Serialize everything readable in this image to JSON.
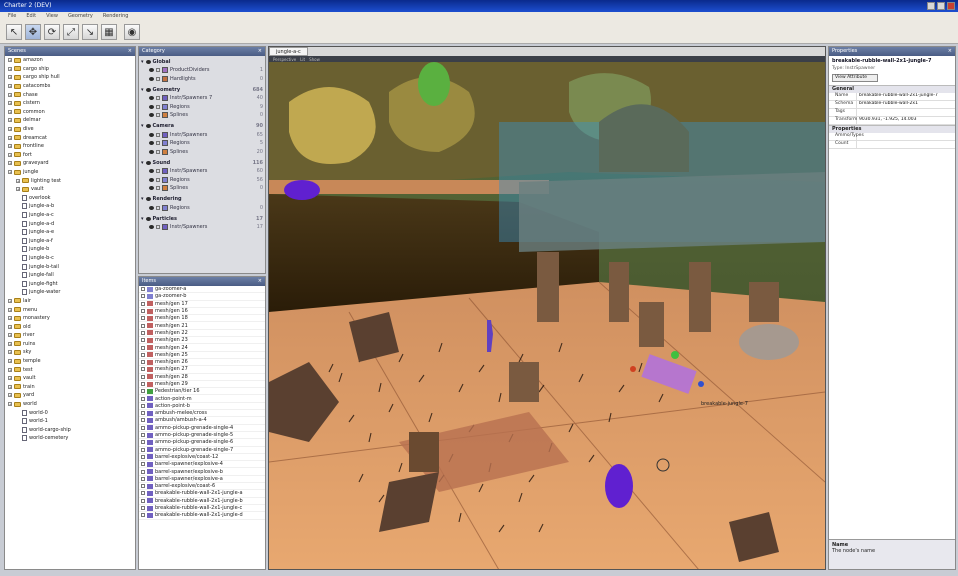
{
  "window": {
    "title": "Charter 2 (DEV)"
  },
  "menu": [
    "File",
    "Edit",
    "View",
    "Geometry",
    "Rendering"
  ],
  "toolbar": {
    "tools": [
      "select-tool",
      "move-tool",
      "rotate-tool",
      "scale-tool",
      "place-tool",
      "grid-tool",
      "render-tool"
    ]
  },
  "left_panel": {
    "title": "Scenes",
    "items": [
      {
        "label": "amazon",
        "type": "folder",
        "depth": 0
      },
      {
        "label": "cargo ship",
        "type": "folder",
        "depth": 0
      },
      {
        "label": "cargo ship hull",
        "type": "folder",
        "depth": 0
      },
      {
        "label": "catacombs",
        "type": "folder",
        "depth": 0
      },
      {
        "label": "chase",
        "type": "folder",
        "depth": 0
      },
      {
        "label": "cistern",
        "type": "folder",
        "depth": 0
      },
      {
        "label": "common",
        "type": "folder",
        "depth": 0
      },
      {
        "label": "delmar",
        "type": "folder",
        "depth": 0
      },
      {
        "label": "dive",
        "type": "folder",
        "depth": 0
      },
      {
        "label": "dreamcat",
        "type": "folder",
        "depth": 0
      },
      {
        "label": "frontline",
        "type": "folder",
        "depth": 0
      },
      {
        "label": "fort",
        "type": "folder",
        "depth": 0
      },
      {
        "label": "graveyard",
        "type": "folder",
        "depth": 0
      },
      {
        "label": "jungle",
        "type": "folder",
        "depth": 0
      },
      {
        "label": "lighting test",
        "type": "folder",
        "depth": 1
      },
      {
        "label": "vault",
        "type": "folder",
        "depth": 1
      },
      {
        "label": "overlook",
        "type": "file",
        "depth": 1
      },
      {
        "label": "jungle-a-b",
        "type": "file",
        "depth": 1
      },
      {
        "label": "jungle-a-c",
        "type": "file",
        "depth": 1
      },
      {
        "label": "jungle-a-d",
        "type": "file",
        "depth": 1
      },
      {
        "label": "jungle-a-e",
        "type": "file",
        "depth": 1
      },
      {
        "label": "jungle-a-f",
        "type": "file",
        "depth": 1
      },
      {
        "label": "jungle-b",
        "type": "file",
        "depth": 1
      },
      {
        "label": "jungle-b-c",
        "type": "file",
        "depth": 1
      },
      {
        "label": "jungle-b-tail",
        "type": "file",
        "depth": 1
      },
      {
        "label": "jungle-fall",
        "type": "file",
        "depth": 1
      },
      {
        "label": "jungle-fight",
        "type": "file",
        "depth": 1
      },
      {
        "label": "jungle-water",
        "type": "file",
        "depth": 1
      },
      {
        "label": "lair",
        "type": "folder",
        "depth": 0
      },
      {
        "label": "menu",
        "type": "folder",
        "depth": 0
      },
      {
        "label": "monastery",
        "type": "folder",
        "depth": 0
      },
      {
        "label": "old",
        "type": "folder",
        "depth": 0
      },
      {
        "label": "river",
        "type": "folder",
        "depth": 0
      },
      {
        "label": "ruins",
        "type": "folder",
        "depth": 0
      },
      {
        "label": "sky",
        "type": "folder",
        "depth": 0
      },
      {
        "label": "temple",
        "type": "folder",
        "depth": 0
      },
      {
        "label": "test",
        "type": "folder",
        "depth": 0
      },
      {
        "label": "vault",
        "type": "folder",
        "depth": 0
      },
      {
        "label": "train",
        "type": "folder",
        "depth": 0
      },
      {
        "label": "yard",
        "type": "folder",
        "depth": 0
      },
      {
        "label": "world",
        "type": "folder",
        "depth": 0
      },
      {
        "label": "world-0",
        "type": "file",
        "depth": 1
      },
      {
        "label": "world-1",
        "type": "file",
        "depth": 1
      },
      {
        "label": "world-cargo-ship",
        "type": "file",
        "depth": 1
      },
      {
        "label": "world-cemetery",
        "type": "file",
        "depth": 1
      }
    ]
  },
  "category_panel": {
    "title": "Category",
    "groups": [
      {
        "name": "Global",
        "count": "",
        "items": [
          {
            "label": "ProductDividers",
            "color": "#a070c0",
            "count": "1"
          },
          {
            "label": "Hardlights",
            "color": "#c07040",
            "count": "0"
          }
        ]
      },
      {
        "name": "Geometry",
        "count": "684",
        "items": [
          {
            "label": "Instr/Spawners 7",
            "color": "#7060c0",
            "count": "40"
          },
          {
            "label": "Regions",
            "color": "#8080d0",
            "count": "9"
          },
          {
            "label": "Splines",
            "color": "#d08040",
            "count": "0"
          }
        ]
      },
      {
        "name": "Camera",
        "count": "90",
        "items": [
          {
            "label": "Instr/Spawners",
            "color": "#7060c0",
            "count": "65"
          },
          {
            "label": "Regions",
            "color": "#8080d0",
            "count": "5"
          },
          {
            "label": "Splines",
            "color": "#d08040",
            "count": "20"
          }
        ]
      },
      {
        "name": "Sound",
        "count": "116",
        "items": [
          {
            "label": "Instr/Spawners",
            "color": "#7060c0",
            "count": "60"
          },
          {
            "label": "Regions",
            "color": "#8080d0",
            "count": "56"
          },
          {
            "label": "Splines",
            "color": "#d08040",
            "count": "0"
          }
        ]
      },
      {
        "name": "Rendering",
        "count": "",
        "items": [
          {
            "label": "Regions",
            "color": "#8080d0",
            "count": "0"
          }
        ]
      },
      {
        "name": "Particles",
        "count": "17",
        "items": [
          {
            "label": "Instr/Spawners",
            "color": "#7060c0",
            "count": "17"
          }
        ]
      }
    ]
  },
  "list_panel": {
    "title": "Items",
    "rows": [
      {
        "label": "ga-zoomer-a",
        "color": "#8080d0"
      },
      {
        "label": "ga-zoomer-b",
        "color": "#8080d0"
      },
      {
        "label": "mesh/gen 17",
        "color": "#c06060"
      },
      {
        "label": "mesh/gen 16",
        "color": "#c06060"
      },
      {
        "label": "mesh/gen 18",
        "color": "#c06060"
      },
      {
        "label": "mesh/gen 21",
        "color": "#c06060"
      },
      {
        "label": "mesh/gen 22",
        "color": "#c06060"
      },
      {
        "label": "mesh/gen 23",
        "color": "#c06060"
      },
      {
        "label": "mesh/gen 24",
        "color": "#c06060"
      },
      {
        "label": "mesh/gen 25",
        "color": "#c06060"
      },
      {
        "label": "mesh/gen 26",
        "color": "#c06060"
      },
      {
        "label": "mesh/gen 27",
        "color": "#c06060"
      },
      {
        "label": "mesh/gen 28",
        "color": "#c06060"
      },
      {
        "label": "mesh/gen 29",
        "color": "#c06060"
      },
      {
        "label": "Pedestrian/tier 16",
        "color": "#40a040"
      },
      {
        "label": "action-point-m",
        "color": "#7060c0"
      },
      {
        "label": "action-point-b",
        "color": "#7060c0"
      },
      {
        "label": "ambush-melee/cross",
        "color": "#7060c0"
      },
      {
        "label": "ambush/ambush-a-4",
        "color": "#7060c0"
      },
      {
        "label": "ammo-pickup-grenade-single-4",
        "color": "#7060c0"
      },
      {
        "label": "ammo-pickup-grenade-single-5",
        "color": "#7060c0"
      },
      {
        "label": "ammo-pickup-grenade-single-6",
        "color": "#7060c0"
      },
      {
        "label": "ammo-pickup-grenade-single-7",
        "color": "#7060c0"
      },
      {
        "label": "barrel-explosive/coast-12",
        "color": "#7060c0"
      },
      {
        "label": "barrel-spawner/explosive-4",
        "color": "#7060c0"
      },
      {
        "label": "barrel-spawner/explosive-b",
        "color": "#7060c0"
      },
      {
        "label": "barrel-spawner/explosive-a",
        "color": "#7060c0"
      },
      {
        "label": "barrel-explosive/coast-6",
        "color": "#7060c0"
      },
      {
        "label": "breakable-rubble-wall-2x1-jungle-a",
        "color": "#7060c0"
      },
      {
        "label": "breakable-rubble-wall-2x1-jungle-b",
        "color": "#7060c0"
      },
      {
        "label": "breakable-rubble-wall-2x1-jungle-c",
        "color": "#7060c0"
      },
      {
        "label": "breakable-rubble-wall-2x1-jungle-d",
        "color": "#7060c0"
      }
    ]
  },
  "viewport": {
    "tab": "jungle-a-c",
    "strip": [
      "Perspective",
      "Lit",
      "Show"
    ],
    "label_tag": "breakable-jungle-7"
  },
  "properties": {
    "title": "Properties",
    "object_name": "breakable-rubble-wall-2x1-jungle-7",
    "object_sub": "Type: InstrSpawner",
    "link": "View Attribute",
    "sections": [
      {
        "name": "General",
        "rows": [
          {
            "k": "Name",
            "v": "breakable-rubble-wall-2x1-jungle-7"
          },
          {
            "k": "Schema",
            "v": "breakable-rubble-wall-2x1"
          },
          {
            "k": "Tags",
            "v": ""
          },
          {
            "k": "Transform",
            "v": "9030.931, -1.925, 14.003"
          }
        ]
      },
      {
        "name": "Properties",
        "rows": [
          {
            "k": "Ammo/Types",
            "v": ""
          },
          {
            "k": "Count",
            "v": ""
          }
        ]
      }
    ],
    "help_title": "Name",
    "help_text": "The node's name"
  },
  "status": ""
}
